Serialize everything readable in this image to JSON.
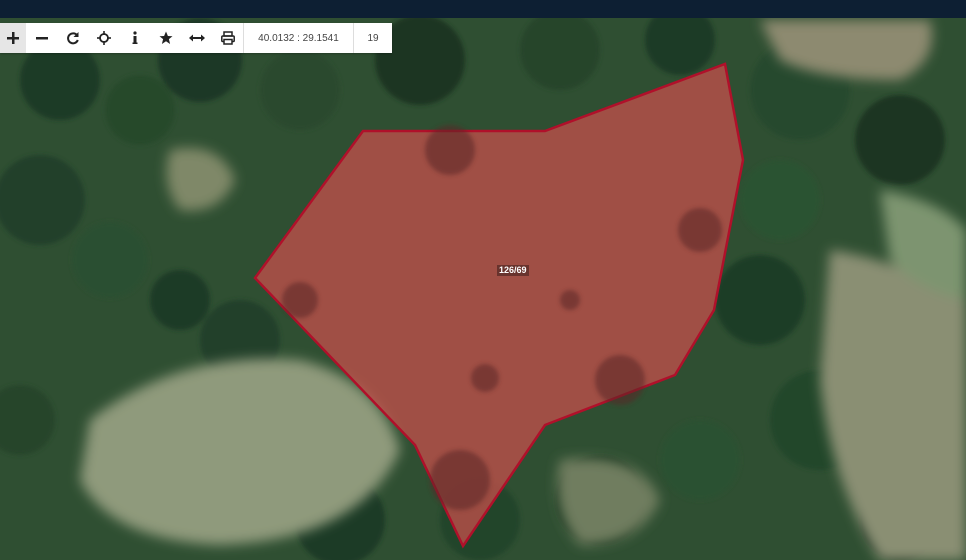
{
  "toolbar": {
    "buttons": [
      {
        "name": "zoom-in-button",
        "icon": "plus-icon"
      },
      {
        "name": "zoom-out-button",
        "icon": "minus-icon"
      },
      {
        "name": "refresh-button",
        "icon": "refresh-icon"
      },
      {
        "name": "locate-button",
        "icon": "crosshair-icon"
      },
      {
        "name": "info-button",
        "icon": "info-icon"
      },
      {
        "name": "favorite-button",
        "icon": "star-icon"
      },
      {
        "name": "measure-button",
        "icon": "arrows-horizontal-icon"
      },
      {
        "name": "print-button",
        "icon": "printer-icon"
      }
    ],
    "coordinates": "40.0132 : 29.1541",
    "zoom_level": "19"
  },
  "map": {
    "parcel_label": "126/69",
    "parcel_stroke_color": "#b0102a",
    "parcel_fill_color": "#c0504a"
  }
}
